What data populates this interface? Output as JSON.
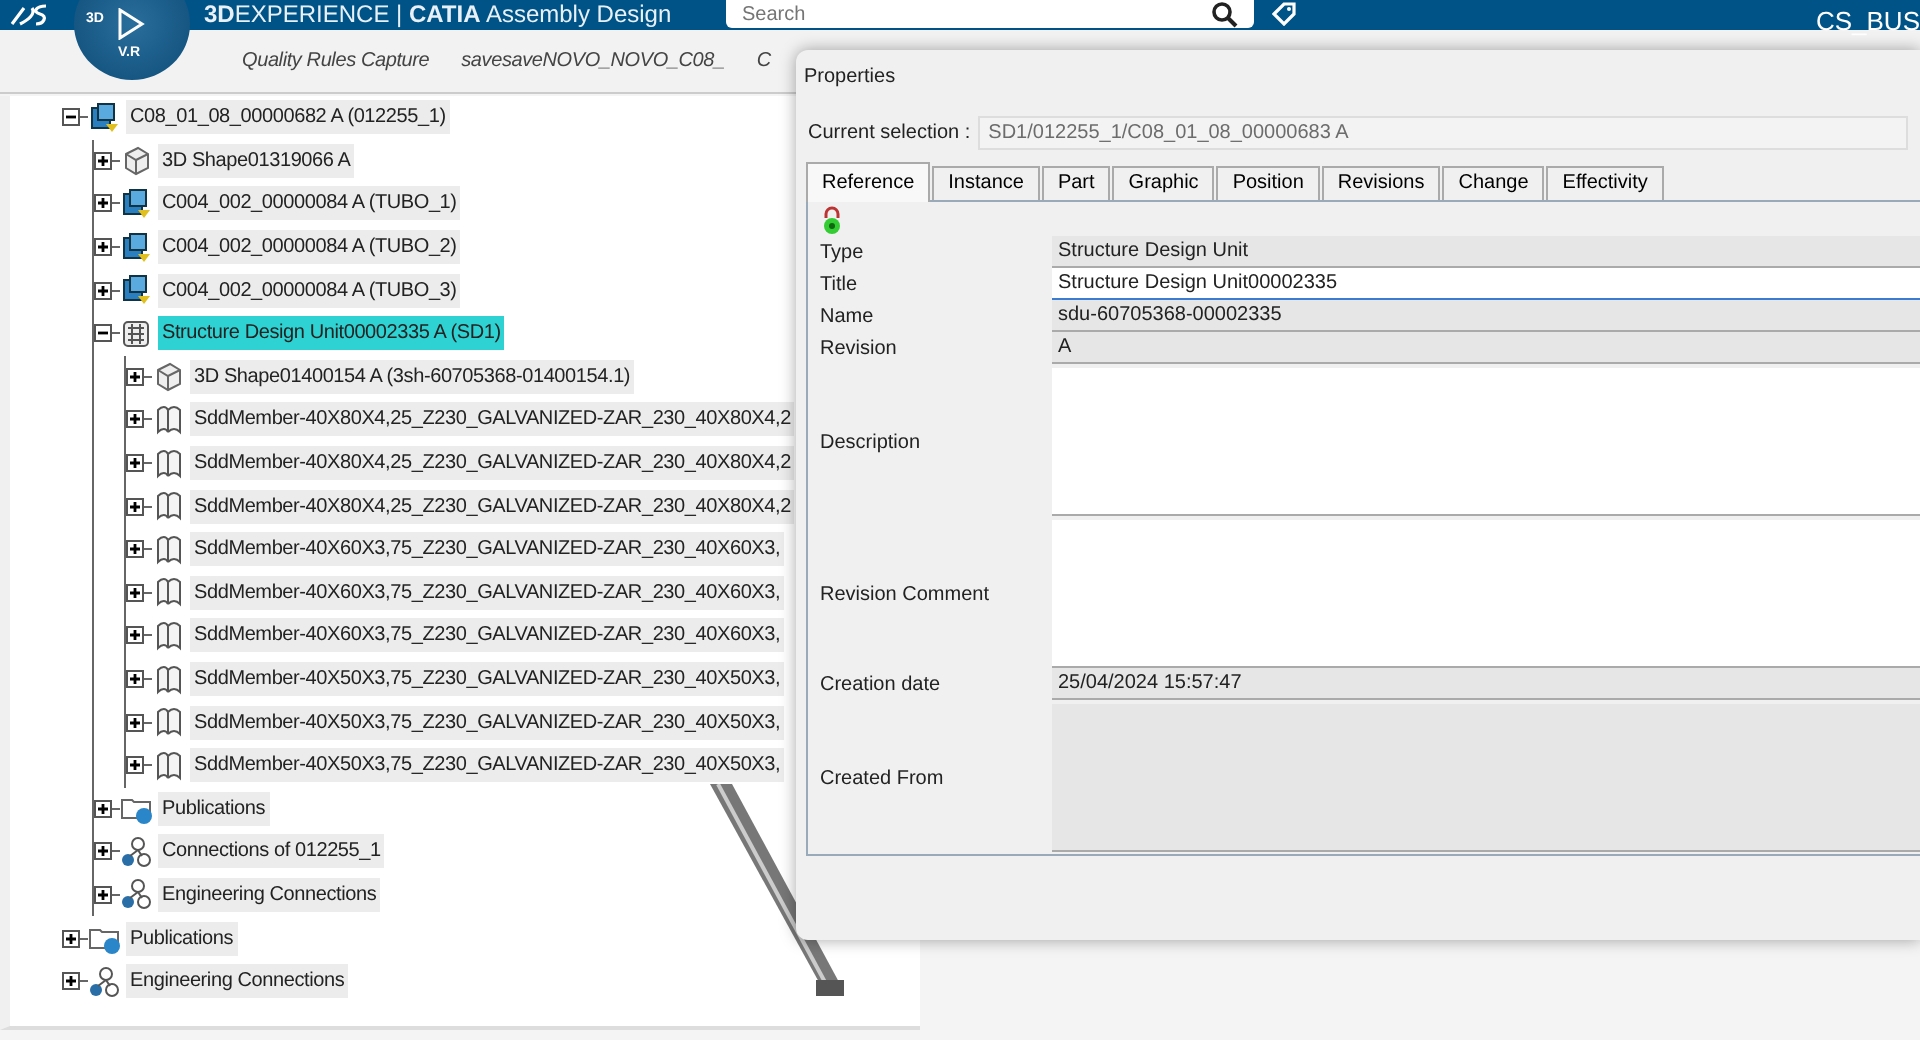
{
  "top_bar": {
    "title": "**3D**EXPERIENCE | **CATIA** Assembly Design",
    "search": {
      "placeholder": "Search"
    },
    "user": "CS_BUS"
  },
  "compass": {
    "top_label": "3D",
    "bottom_label": "V.R"
  },
  "tabs": [
    {
      "label": "Quality Rules Capture",
      "selected": false
    },
    {
      "label": "savesaveNOVO_NOVO_C08_",
      "selected": false
    },
    {
      "label": "C",
      "selected": false
    }
  ],
  "tree": [
    {
      "label": "C08_01_08_00000682 A (012255_1)",
      "kind": "product",
      "expanded": true,
      "selected": false,
      "children": [
        {
          "label": "3D Shape01319066 A",
          "kind": "shape",
          "expanded": false,
          "selected": false
        },
        {
          "label": "C004_002_00000084 A (TUBO_1)",
          "kind": "product",
          "expanded": false,
          "selected": false
        },
        {
          "label": "C004_002_00000084 A (TUBO_2)",
          "kind": "product",
          "expanded": false,
          "selected": false
        },
        {
          "label": "C004_002_00000084 A (TUBO_3)",
          "kind": "product",
          "expanded": false,
          "selected": false
        },
        {
          "label": "Structure Design Unit00002335 A (SD1)",
          "kind": "unit",
          "expanded": true,
          "selected": true,
          "children": [
            {
              "label": "3D Shape01400154 A (3sh-60705368-01400154.1)",
              "kind": "shape",
              "expanded": false,
              "selected": false
            },
            {
              "label": "SddMember-40X80X4,25_Z230_GALVANIZED-ZAR_230_40X80X4,2",
              "kind": "member",
              "expanded": false,
              "selected": false
            },
            {
              "label": "SddMember-40X80X4,25_Z230_GALVANIZED-ZAR_230_40X80X4,2",
              "kind": "member",
              "expanded": false,
              "selected": false
            },
            {
              "label": "SddMember-40X80X4,25_Z230_GALVANIZED-ZAR_230_40X80X4,2",
              "kind": "member",
              "expanded": false,
              "selected": false
            },
            {
              "label": "SddMember-40X60X3,75_Z230_GALVANIZED-ZAR_230_40X60X3,",
              "kind": "member",
              "expanded": false,
              "selected": false
            },
            {
              "label": "SddMember-40X60X3,75_Z230_GALVANIZED-ZAR_230_40X60X3,",
              "kind": "member",
              "expanded": false,
              "selected": false
            },
            {
              "label": "SddMember-40X60X3,75_Z230_GALVANIZED-ZAR_230_40X60X3,",
              "kind": "member",
              "expanded": false,
              "selected": false
            },
            {
              "label": "SddMember-40X50X3,75_Z230_GALVANIZED-ZAR_230_40X50X3,",
              "kind": "member",
              "expanded": false,
              "selected": false
            },
            {
              "label": "SddMember-40X50X3,75_Z230_GALVANIZED-ZAR_230_40X50X3,",
              "kind": "member",
              "expanded": false,
              "selected": false
            },
            {
              "label": "SddMember-40X50X3,75_Z230_GALVANIZED-ZAR_230_40X50X3,",
              "kind": "member",
              "expanded": false,
              "selected": false
            }
          ]
        },
        {
          "label": "Publications",
          "kind": "publications",
          "expanded": false,
          "selected": false
        },
        {
          "label": "Connections of 012255_1",
          "kind": "connections",
          "expanded": false,
          "selected": false
        },
        {
          "label": "Engineering Connections",
          "kind": "connections",
          "expanded": false,
          "selected": false
        }
      ]
    },
    {
      "label": "Publications",
      "kind": "publications",
      "expanded": false,
      "selected": false
    },
    {
      "label": "Engineering Connections",
      "kind": "connections",
      "expanded": false,
      "selected": false
    }
  ],
  "properties_dialog": {
    "title": "Properties",
    "current_selection": {
      "label": "Current selection :",
      "value": "SD1/012255_1/C08_01_08_00000683 A",
      "disabled": true
    },
    "tabs": [
      {
        "label": "Reference",
        "selected": true
      },
      {
        "label": "Instance",
        "selected": false
      },
      {
        "label": "Part",
        "selected": false
      },
      {
        "label": "Graphic",
        "selected": false
      },
      {
        "label": "Position",
        "selected": false
      },
      {
        "label": "Revisions",
        "selected": false
      },
      {
        "label": "Change",
        "selected": false
      },
      {
        "label": "Effectivity",
        "selected": false
      }
    ],
    "fields": [
      {
        "label": "Type",
        "kind": "line",
        "editable": false,
        "focused": false,
        "value": "Structure Design Unit"
      },
      {
        "label": "Title",
        "kind": "line",
        "editable": true,
        "focused": true,
        "value": "Structure Design Unit00002335"
      },
      {
        "label": "Name",
        "kind": "line",
        "editable": false,
        "focused": false,
        "value": "sdu-60705368-00002335"
      },
      {
        "label": "Revision",
        "kind": "line",
        "editable": false,
        "focused": false,
        "value": "A"
      },
      {
        "label": "Description",
        "kind": "multi",
        "editable": true,
        "focused": false
      },
      {
        "label": "Revision Comment",
        "kind": "multi",
        "editable": true,
        "focused": false
      },
      {
        "label": "Creation date",
        "kind": "line",
        "editable": false,
        "focused": false,
        "value": "25/04/2024 15:57:47"
      },
      {
        "label": "Created From",
        "kind": "multi",
        "editable": false,
        "focused": false
      }
    ]
  }
}
